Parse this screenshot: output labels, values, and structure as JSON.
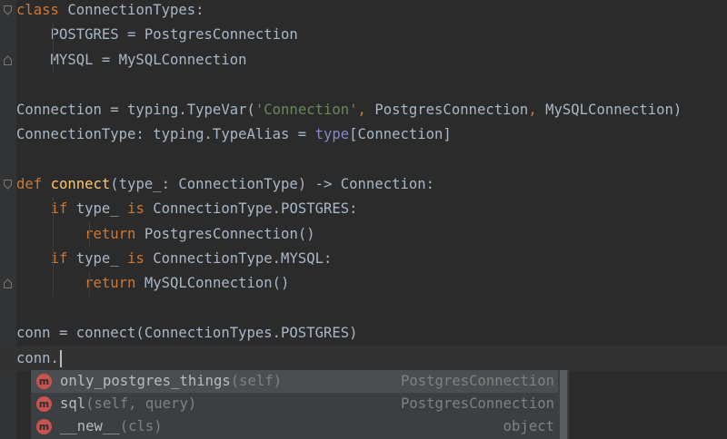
{
  "editor": {
    "lines": [
      [
        {
          "t": "class",
          "c": "kw"
        },
        {
          "t": " ",
          "c": "id"
        },
        {
          "t": "ConnectionTypes:",
          "c": "id"
        }
      ],
      [
        {
          "t": "    POSTGRES = PostgresConnection",
          "c": "id"
        }
      ],
      [
        {
          "t": "    MYSQL = MySQLConnection",
          "c": "id"
        }
      ],
      [],
      [
        {
          "t": "Connection = typing.TypeVar(",
          "c": "id"
        },
        {
          "t": "'Connection'",
          "c": "st"
        },
        {
          "t": ", ",
          "c": "kw"
        },
        {
          "t": "PostgresConnection",
          "c": "id"
        },
        {
          "t": ", ",
          "c": "kw"
        },
        {
          "t": "MySQLConnection)",
          "c": "id"
        }
      ],
      [
        {
          "t": "ConnectionType: typing.TypeAlias = ",
          "c": "id"
        },
        {
          "t": "type",
          "c": "bi"
        },
        {
          "t": "[Connection]",
          "c": "id"
        }
      ],
      [],
      [
        {
          "t": "def",
          "c": "kw"
        },
        {
          "t": " ",
          "c": "id"
        },
        {
          "t": "connect",
          "c": "fn"
        },
        {
          "t": "(type_: ConnectionType) -> Connection:",
          "c": "id"
        }
      ],
      [
        {
          "t": "    ",
          "c": "id"
        },
        {
          "t": "if",
          "c": "kw"
        },
        {
          "t": " type_ ",
          "c": "id"
        },
        {
          "t": "is",
          "c": "kw"
        },
        {
          "t": " ConnectionType.POSTGRES:",
          "c": "id"
        }
      ],
      [
        {
          "t": "        ",
          "c": "id"
        },
        {
          "t": "return",
          "c": "kw"
        },
        {
          "t": " PostgresConnection()",
          "c": "id"
        }
      ],
      [
        {
          "t": "    ",
          "c": "id"
        },
        {
          "t": "if",
          "c": "kw"
        },
        {
          "t": " type_ ",
          "c": "id"
        },
        {
          "t": "is",
          "c": "kw"
        },
        {
          "t": " ConnectionType.MYSQL:",
          "c": "id"
        }
      ],
      [
        {
          "t": "        ",
          "c": "id"
        },
        {
          "t": "return",
          "c": "kw"
        },
        {
          "t": " MySQLConnection()",
          "c": "id"
        }
      ],
      [],
      [
        {
          "t": "conn = connect(ConnectionTypes.POSTGRES)",
          "c": "id"
        }
      ],
      [
        {
          "t": "conn.",
          "c": "id"
        }
      ]
    ]
  },
  "completion": {
    "items": [
      {
        "icon_name": "method-icon",
        "icon_letter": "m",
        "name": "only_postgres_things",
        "params": "(self)",
        "type": "PostgresConnection"
      },
      {
        "icon_name": "method-icon",
        "icon_letter": "m",
        "name": "sql",
        "params": "(self, query)",
        "type": "PostgresConnection"
      },
      {
        "icon_name": "method-icon",
        "icon_letter": "m",
        "name": "__new__",
        "params": "(cls)",
        "type": "object"
      }
    ]
  },
  "colors": {
    "background": "#2b2b2b",
    "keyword": "#cc7832",
    "identifier": "#a9b7c6",
    "function": "#ffc66d",
    "string": "#6a8759",
    "builtin": "#8888c6",
    "method_icon": "#c75450",
    "popup_background": "#3c3f41"
  }
}
